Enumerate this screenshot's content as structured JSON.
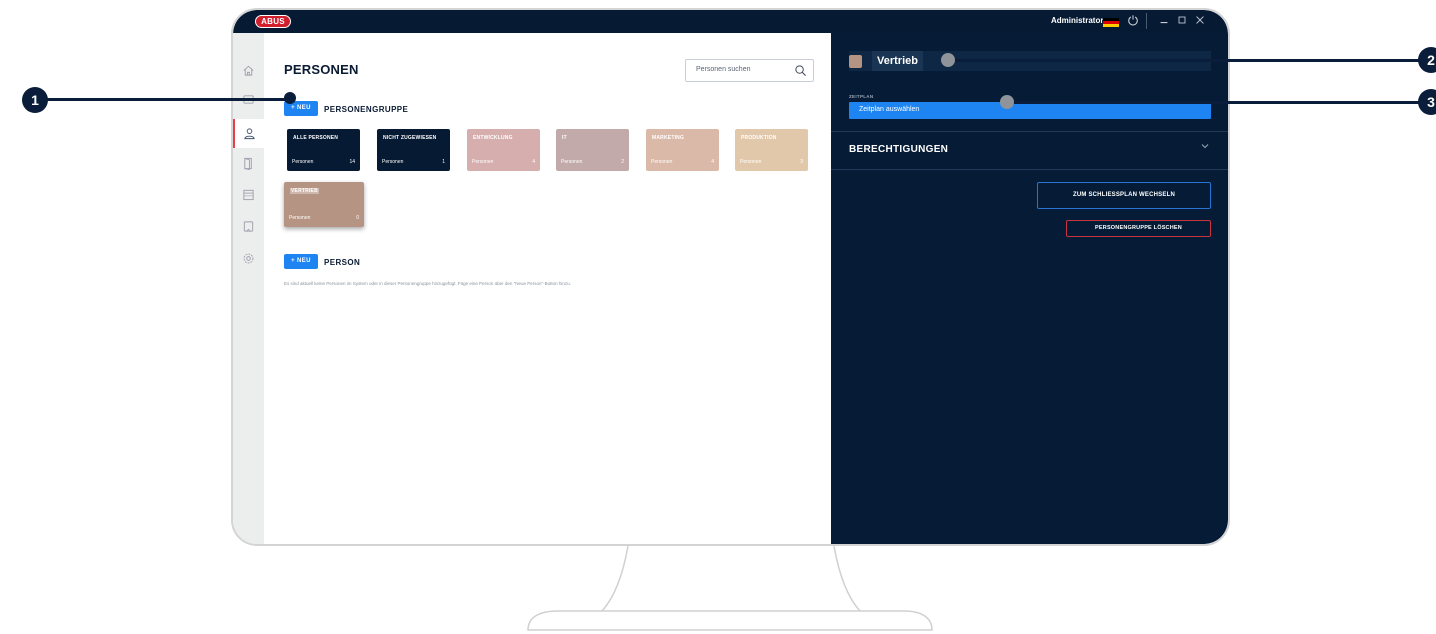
{
  "titlebar": {
    "brand": "ABUS",
    "user": "Administrator",
    "flag_colors": [
      "#000000",
      "#dd0000",
      "#ffce00"
    ]
  },
  "sidebar": {
    "items": [
      {
        "icon": "home-icon"
      },
      {
        "icon": "lock-device-icon"
      },
      {
        "icon": "person-icon",
        "active": true
      },
      {
        "icon": "door-icon"
      },
      {
        "icon": "calendar-icon"
      },
      {
        "icon": "tablet-icon"
      },
      {
        "icon": "gear-icon"
      }
    ]
  },
  "main": {
    "title": "PERSONEN",
    "search_placeholder": "Personen suchen",
    "new_label": "+ NEU",
    "groups_label": "PERSONENGRUPPE",
    "persons_label": "PERSON",
    "empty_text": "Es sind aktuell keine Personen im System oder in dieser Personengruppe hinzugefügt. Füge eine Person über den \"Neue Person\"-Button hinzu.",
    "cards": [
      {
        "title": "ALLE PERSONEN",
        "sub": "Personen",
        "count": "14",
        "color": "#061a33"
      },
      {
        "title": "NICHT ZUGEWIESEN",
        "sub": "Personen",
        "count": "1",
        "color": "#061a33"
      },
      {
        "title": "ENTWICKLUNG",
        "sub": "Personen",
        "count": "4",
        "color": "#d6aeae"
      },
      {
        "title": "IT",
        "sub": "Personen",
        "count": "2",
        "color": "#c2aaab"
      },
      {
        "title": "MARKETING",
        "sub": "Personen",
        "count": "4",
        "color": "#dbb9a8"
      },
      {
        "title": "PRODUKTION",
        "sub": "Personen",
        "count": "3",
        "color": "#e2c8aa"
      },
      {
        "title": "VERTRIEB",
        "sub": "Personen",
        "count": "0",
        "color": "#b69483"
      }
    ]
  },
  "detail": {
    "name": "Vertrieb",
    "schedule_label": "ZEITPLAN",
    "schedule_value": "Zeitplan auswählen",
    "permissions_label": "BERECHTIGUNGEN",
    "switch_button": "ZUM SCHLIESSPLAN WECHSELN",
    "delete_button": "PERSONENGRUPPE LÖSCHEN"
  },
  "callouts": [
    "1",
    "2",
    "3"
  ]
}
